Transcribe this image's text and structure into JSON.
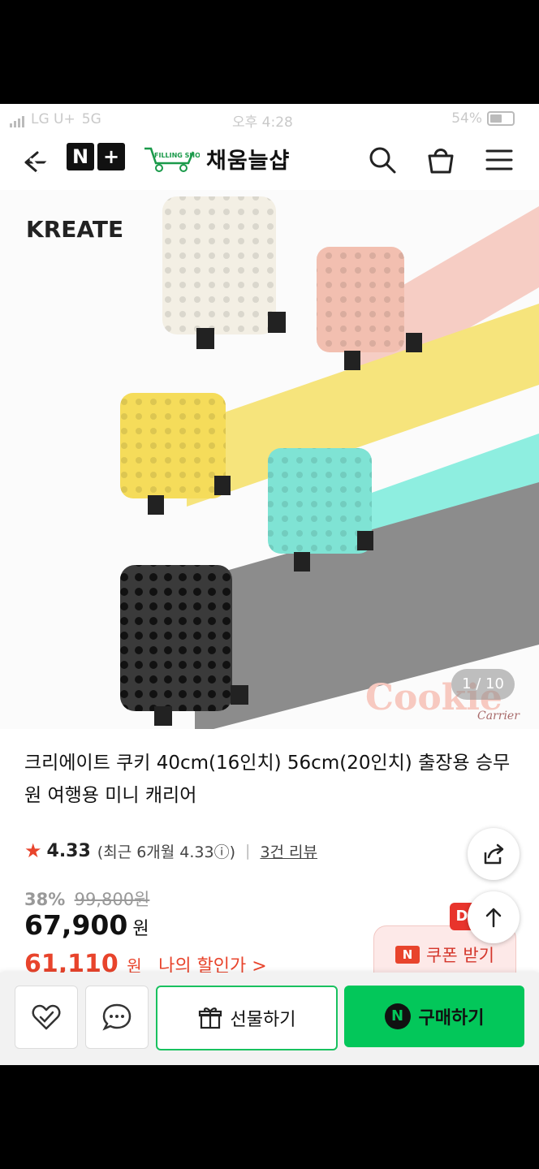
{
  "status": {
    "carrier": "LG U+",
    "network": "5G",
    "time": "오후 4:28",
    "battery": "54%"
  },
  "header": {
    "badge_n": "N",
    "badge_plus": "+",
    "store_logo_text": "FILLING SHOP",
    "store_name": "채움늘샵"
  },
  "hero": {
    "brand": "KREATE",
    "watermark": "Cookie",
    "watermark_sub": "Carrier",
    "counter": "1 / 10"
  },
  "product": {
    "title": "크리에이트 쿠키 40cm(16인치) 56cm(20인치) 출장용 승무원 여행용 미니 캐리어",
    "rating_score": "4.33",
    "rating_recent": "(최근 6개월 4.33",
    "rating_info": "ⓘ)",
    "review_count": "3건 리뷰",
    "discount_rate": "38%",
    "original_price": "99,800원",
    "price": "67,900",
    "price_unit": "원",
    "my_price": "61,110",
    "my_price_unit": "원",
    "my_price_label": "나의 할인가 >"
  },
  "coupon": {
    "badge": "N",
    "label": "쿠폰 받기",
    "red_badge": "D"
  },
  "bottom": {
    "gift_label": "선물하기",
    "buy_label": "구매하기",
    "buy_badge": "N"
  },
  "colors": {
    "naver_green": "#03c75a",
    "accent_red": "#e8442c"
  }
}
